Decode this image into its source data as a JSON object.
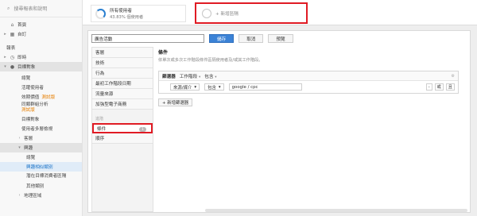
{
  "sidebar": {
    "search_placeholder": "搜尋報表和說明",
    "items": [
      {
        "icon": "home-icon",
        "label": "首頁",
        "chev": ""
      },
      {
        "icon": "grid-icon",
        "label": "自訂",
        "chev": "▸"
      }
    ],
    "section_reports": "報表",
    "items2": [
      {
        "icon": "clock-icon",
        "label": "即時",
        "chev": "▸"
      },
      {
        "icon": "person-icon",
        "label": "目標對象",
        "chev": "▾"
      }
    ],
    "audience_children": [
      "總覽",
      "活躍使用者",
      "效期價值",
      "同類群組分析",
      "目標對象",
      "使用者多層檢視"
    ],
    "beta_label": "測試版",
    "audience_more": [
      {
        "label": "客層",
        "chev": "›"
      },
      {
        "label": "興趣",
        "chev": "▾"
      }
    ],
    "interest_children": [
      "總覽",
      "興趣相似類別",
      "潛在目標消費者區隔",
      "其他類別"
    ],
    "geo": {
      "label": "地理區域",
      "chev": "›"
    }
  },
  "segments": {
    "seg1_title": "所有使用者",
    "seg1_sub": "43.83% 個使用者",
    "add_segment": "+ 新增區隔"
  },
  "editor": {
    "segment_name_value": "廣告活動",
    "save_label": "儲存",
    "cancel_label": "取消",
    "preview_label": "預覽",
    "categories": [
      "客層",
      "技術",
      "行為",
      "最初工作階段日期",
      "流量來源",
      "加強型電子商務"
    ],
    "group_label": "進階",
    "conditions_label": "條件",
    "conditions_count": "1",
    "sequences_label": "順序",
    "section_title": "條件",
    "section_desc": "依單次或多次工作階段條件區隔使用者及/或其工作階段。",
    "filter_head": {
      "filter_label": "篩選器",
      "scope": "工作階段",
      "mode": "包含"
    },
    "filter_row": {
      "dimension": "來源/媒介",
      "operator": "包含",
      "value": "google / cpc",
      "minus": "-",
      "or_label": "或",
      "and_label": "且"
    },
    "add_filter_label": "+ 新增篩選器"
  },
  "colors": {
    "accent": "#3b82d6",
    "highlight": "#e01b24",
    "beta": "#e67e00"
  }
}
